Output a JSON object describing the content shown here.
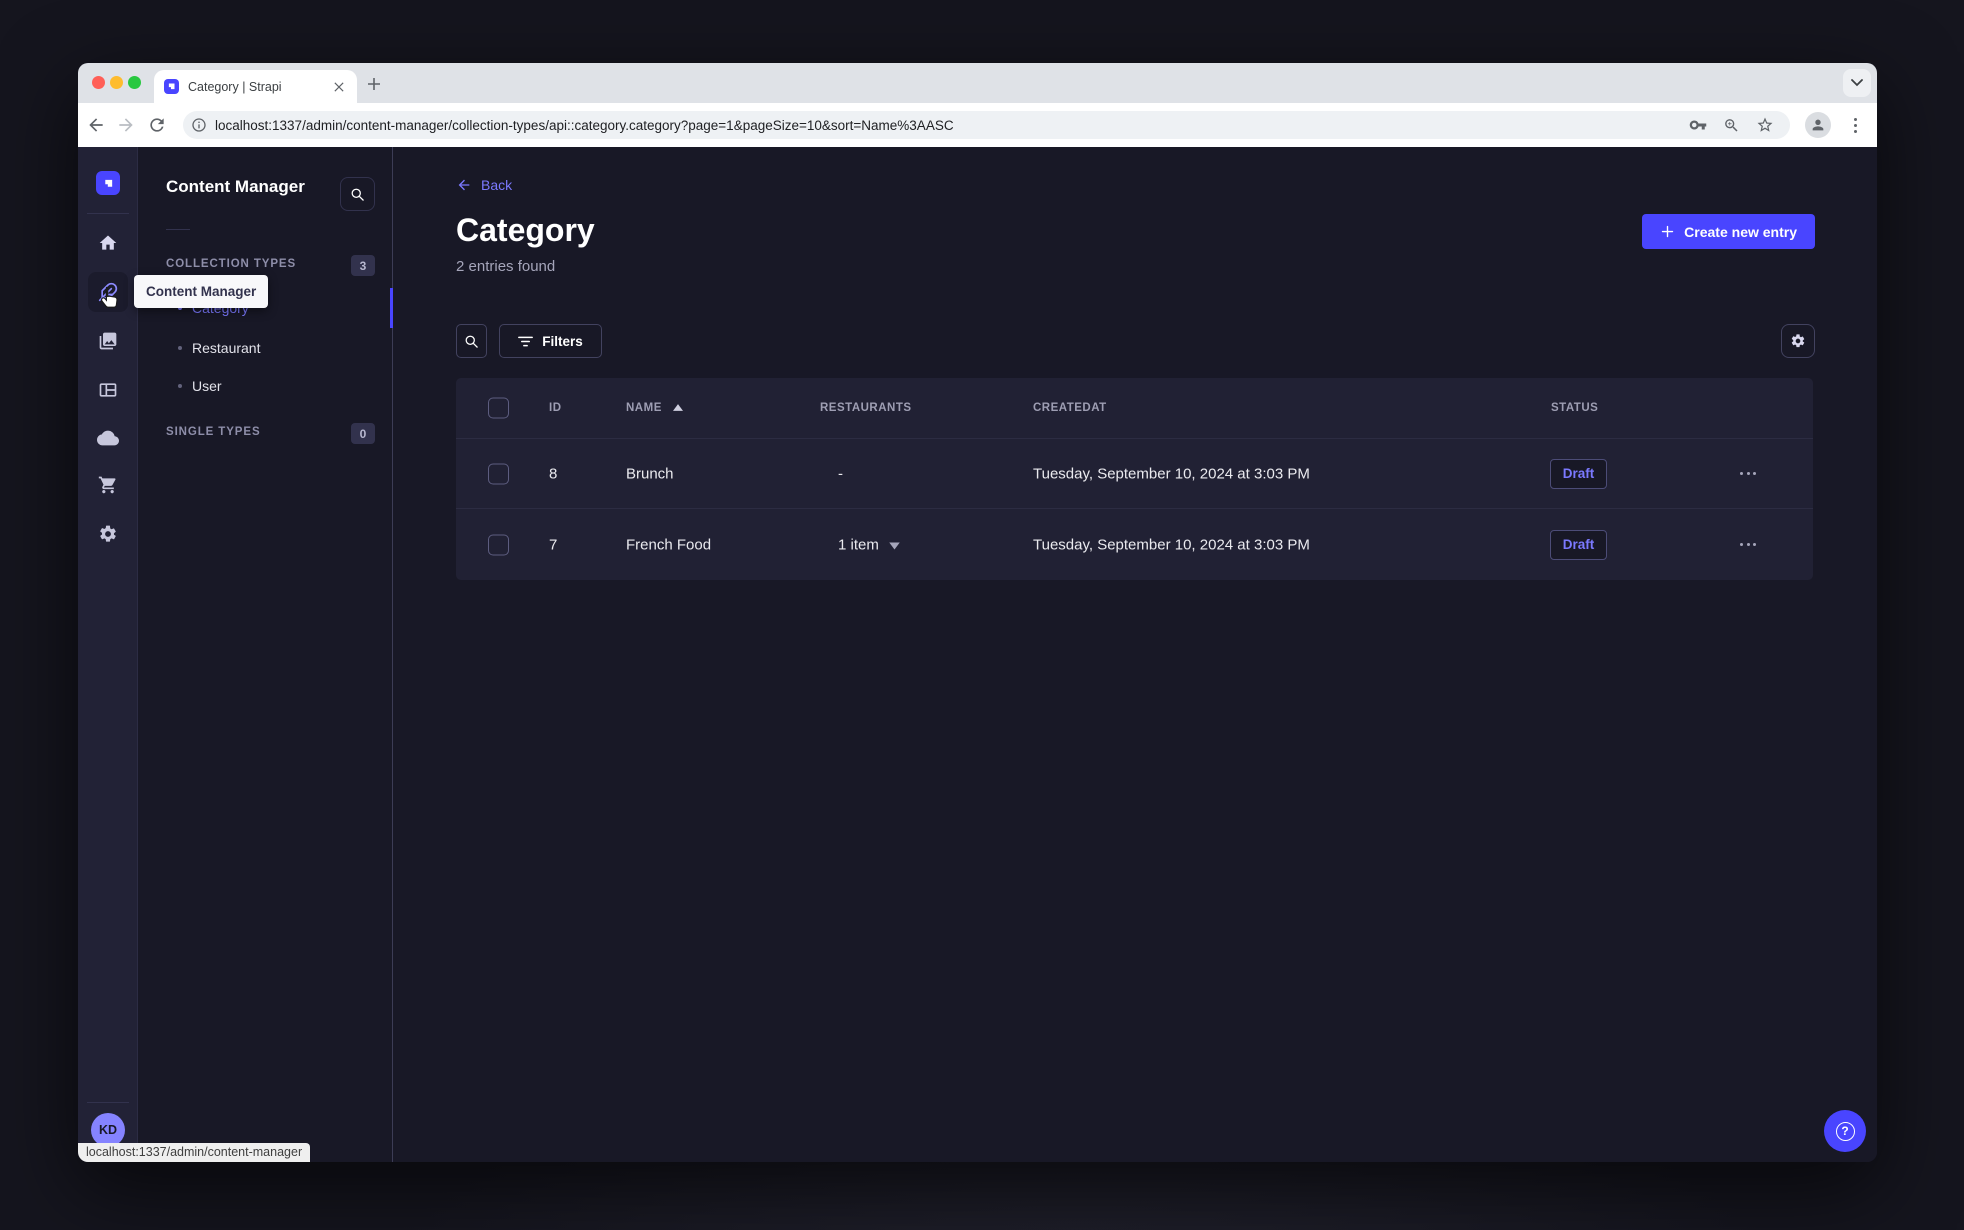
{
  "browser": {
    "tab_title": "Category | Strapi",
    "url": "localhost:1337/admin/content-manager/collection-types/api::category.category?page=1&pageSize=10&sort=Name%3AASC"
  },
  "navbar": {
    "avatar_initials": "KD"
  },
  "subnav": {
    "title": "Content Manager",
    "collection_types_label": "COLLECTION TYPES",
    "collection_types_count": "3",
    "items": [
      {
        "label": "Category"
      },
      {
        "label": "Restaurant"
      },
      {
        "label": "User"
      }
    ],
    "single_types_label": "SINGLE TYPES",
    "single_types_count": "0"
  },
  "tooltip": {
    "text": "Content Manager"
  },
  "main": {
    "back_label": "Back",
    "title": "Category",
    "subtitle": "2 entries found",
    "create_button_label": "Create new entry",
    "filters_button_label": "Filters"
  },
  "table": {
    "headers": {
      "id": "ID",
      "name": "NAME",
      "restaurants": "RESTAURANTS",
      "createdat": "CREATEDAT",
      "status": "STATUS"
    },
    "rows": [
      {
        "id": "8",
        "name": "Brunch",
        "restaurants": "-",
        "createdat": "Tuesday, September 10, 2024 at 3:03 PM",
        "status": "Draft"
      },
      {
        "id": "7",
        "name": "French Food",
        "restaurants": "1 item",
        "createdat": "Tuesday, September 10, 2024 at 3:03 PM",
        "status": "Draft"
      }
    ]
  },
  "statusbar": {
    "link_preview": "localhost:1337/admin/content-manager"
  },
  "colors": {
    "primary": "#4945ff",
    "primary_light": "#7b79ff"
  }
}
